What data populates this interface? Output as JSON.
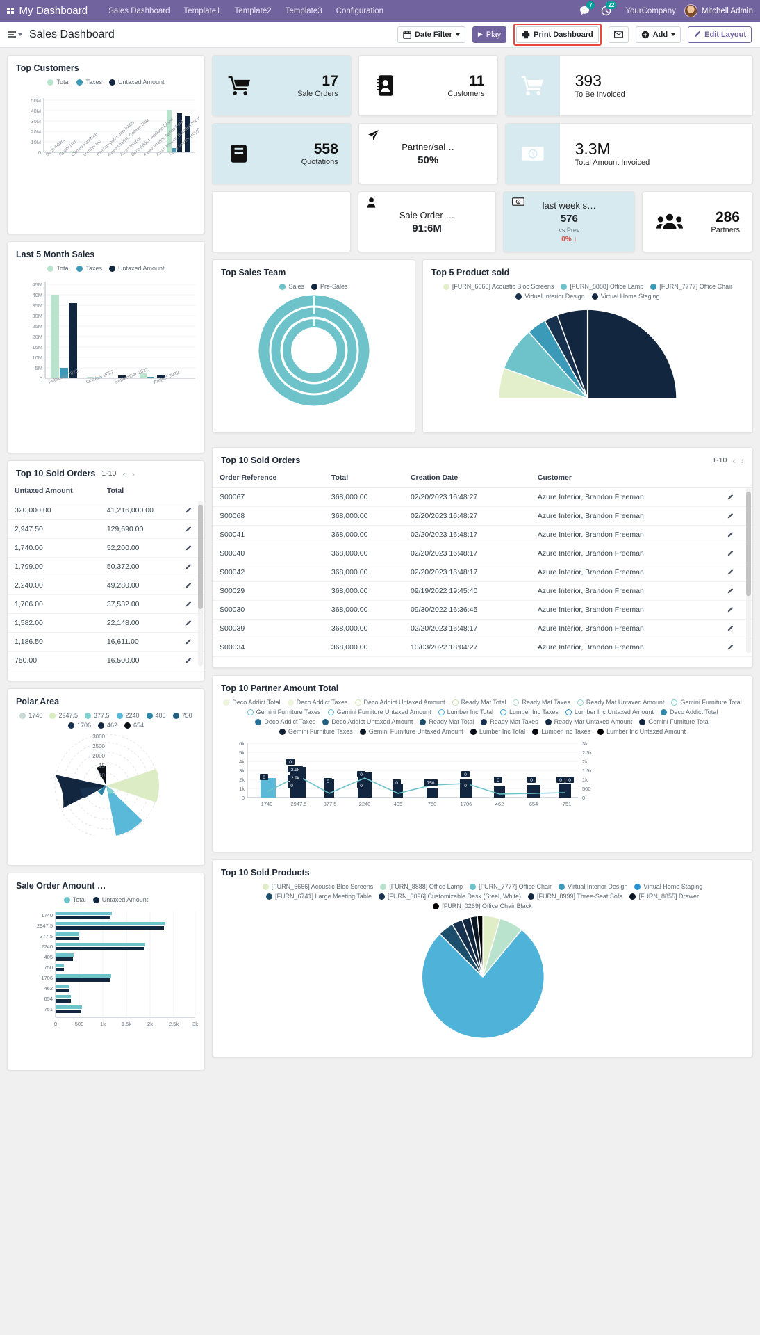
{
  "navbar": {
    "apps_icon": "grid-apps-icon",
    "brand": "My Dashboard",
    "menus": [
      "Sales Dashboard",
      "Template1",
      "Template2",
      "Template3",
      "Configuration"
    ],
    "messages_badge": "7",
    "activities_badge": "22",
    "company": "YourCompany",
    "user": "Mitchell Admin",
    "brand_color": "#71639e"
  },
  "controlbar": {
    "title": "Sales Dashboard",
    "date_filter": "Date Filter",
    "play": "Play",
    "print": "Print Dashboard",
    "add": "Add",
    "edit_layout": "Edit Layout",
    "highlight_color": "#e8483f"
  },
  "kpis": [
    {
      "id": "sale-orders",
      "value": "17",
      "label": "Sale Orders",
      "icon": "cart-icon",
      "style": "tinted"
    },
    {
      "id": "customers",
      "value": "11",
      "label": "Customers",
      "icon": "contact-icon",
      "style": "plain"
    },
    {
      "id": "to-be-invoiced",
      "value": "393",
      "label": "To Be Invoiced",
      "icon": "cart-icon",
      "style": "wide"
    },
    {
      "id": "quotations",
      "value": "558",
      "label": "Quotations",
      "icon": "book-icon",
      "style": "tinted"
    },
    {
      "id": "partner-sale",
      "value": "50%",
      "label": "Partner/sal…",
      "icon": "paper-plane-icon",
      "style": "center"
    },
    {
      "id": "total-invoiced",
      "value": "3.3M",
      "label": "Total Amount Invoiced",
      "icon": "banknote-icon",
      "style": "wide"
    },
    {
      "id": "empty",
      "value": "",
      "label": "",
      "icon": "",
      "style": "empty"
    },
    {
      "id": "sale-order-amt",
      "value": "91:6M",
      "label": "Sale Order …",
      "icon": "user-icon",
      "style": "center"
    }
  ],
  "kpi_week": {
    "label": "last week s…",
    "value": "576",
    "sub": "vs Prev",
    "delta": "0%",
    "delta_arrow": "↓",
    "icon": "banknote-icon"
  },
  "kpi_partners": {
    "value": "286",
    "label": "Partners",
    "icon": "people-icon"
  },
  "chart_data": [
    {
      "id": "top-customers",
      "title": "Top Customers",
      "type": "bar",
      "legend": [
        {
          "label": "Total",
          "color": "#b9e3cd"
        },
        {
          "label": "Taxes",
          "color": "#3b9ab8"
        },
        {
          "label": "Untaxed Amount",
          "color": "#12263f"
        }
      ],
      "categories": [
        "Deco Addict",
        "Ready Mat",
        "Gemini Furniture",
        "Lumber Inc",
        "YourCompany, Joel Willis",
        "Azure Interior, Colleen Diaz",
        "Azure Interior",
        "Deco Addict, Addison Olson",
        "Azure Interior, Nicole Ford",
        "Azure Interior, Brandon Freeman",
        "Azure Interior (copy)"
      ],
      "ytick_labels": [
        "50M",
        "40M",
        "30M",
        "20M",
        "10M",
        "0"
      ],
      "ylim": [
        0,
        50
      ],
      "series": [
        {
          "name": "Total",
          "values": [
            0,
            0,
            0,
            0.3,
            0,
            0.5,
            0,
            0,
            0,
            41,
            0
          ]
        },
        {
          "name": "Taxes",
          "values": [
            0,
            0,
            0,
            0,
            0,
            0,
            0,
            0,
            0,
            0,
            0
          ]
        },
        {
          "name": "Untaxed Amount",
          "values": [
            0,
            0,
            0,
            0,
            0,
            0,
            0,
            0,
            0,
            38,
            36
          ]
        }
      ],
      "grid": true,
      "legend_position": "top"
    },
    {
      "id": "last-5-month-sales",
      "title": "Last 5 Month Sales",
      "type": "bar",
      "legend": [
        {
          "label": "Total",
          "color": "#b9e3cd"
        },
        {
          "label": "Taxes",
          "color": "#3b9ab8"
        },
        {
          "label": "Untaxed Amount",
          "color": "#12263f"
        }
      ],
      "categories": [
        "February 2023",
        "October 2022",
        "September 2022",
        "August 2022"
      ],
      "ytick_labels": [
        "45M",
        "40M",
        "35M",
        "30M",
        "25M",
        "20M",
        "15M",
        "10M",
        "5M",
        "0"
      ],
      "ylim": [
        0,
        45
      ],
      "series": [
        {
          "name": "Total",
          "values": [
            40.0,
            0.3,
            0.2,
            1.0
          ]
        },
        {
          "name": "Taxes",
          "values": [
            5.0,
            0.1,
            0.1,
            0.3
          ]
        },
        {
          "name": "Untaxed Amount",
          "values": [
            36.0,
            0.2,
            0.6,
            1.0
          ]
        }
      ],
      "grid": true,
      "legend_position": "top"
    },
    {
      "id": "top-sales-team",
      "title": "Top Sales Team",
      "type": "doughnut",
      "legend": [
        {
          "label": "Sales",
          "color": "#6ec3cb"
        },
        {
          "label": "Pre-Sales",
          "color": "#12263f"
        }
      ],
      "values": [
        88,
        12
      ],
      "rings": 3
    },
    {
      "id": "top-5-product-sold",
      "title": "Top 5 Product sold",
      "type": "pie",
      "legend": [
        {
          "label": "[FURN_6666] Acoustic Bloc Screens",
          "color": "#e3eecb"
        },
        {
          "label": "[FURN_8888] Office Lamp",
          "color": "#6ec3cb"
        },
        {
          "label": "[FURN_7777] Office Chair",
          "color": "#3b9ab8"
        },
        {
          "label": "Virtual Interior Design",
          "color": "#17314f"
        },
        {
          "label": "Virtual Home Staging",
          "color": "#12263f"
        }
      ],
      "values": [
        18,
        10,
        4,
        3,
        65
      ]
    },
    {
      "id": "polar-area",
      "title": "Polar Area",
      "type": "polar",
      "legend": [
        {
          "label": "1740",
          "color": "#c9d9d6"
        },
        {
          "label": "2947.5",
          "color": "#d9ecc0"
        },
        {
          "label": "377.5",
          "color": "#7fd0ce"
        },
        {
          "label": "2240",
          "color": "#5ab9d8"
        },
        {
          "label": "405",
          "color": "#2e86a8"
        },
        {
          "label": "750",
          "color": "#1f5f80"
        },
        {
          "label": "1706",
          "color": "#17314f"
        },
        {
          "label": "462",
          "color": "#12263f"
        },
        {
          "label": "654",
          "color": "#0b0f16"
        }
      ],
      "rtick_labels": [
        "3000",
        "2500",
        "2000",
        "15",
        "10"
      ],
      "values": [
        1740,
        2947.5,
        377.5,
        2240,
        405,
        750,
        1706,
        462,
        654
      ]
    },
    {
      "id": "top-10-partner-amount-total",
      "title": "Top 10 Partner Amount Total",
      "type": "bar",
      "legend": [
        {
          "label": "Deco Addict Total",
          "color": "#edf4dd",
          "ring": false
        },
        {
          "label": "Deco Addict Taxes",
          "color": "#edf4dd",
          "ring": false
        },
        {
          "label": "Deco Addict Untaxed Amount",
          "color": "#d7ebb2",
          "ring": true
        },
        {
          "label": "Ready Mat Total",
          "color": "#c9e6a8",
          "ring": true
        },
        {
          "label": "Ready Mat Taxes",
          "color": "#a8dcc0",
          "ring": true
        },
        {
          "label": "Ready Mat Untaxed Amount",
          "color": "#8ed6c8",
          "ring": true
        },
        {
          "label": "Gemini Furniture Total",
          "color": "#76cfd0",
          "ring": true
        },
        {
          "label": "Gemini Furniture Taxes",
          "color": "#62c6d4",
          "ring": true
        },
        {
          "label": "Gemini Furniture Untaxed Amount",
          "color": "#55bcd9",
          "ring": true
        },
        {
          "label": "Lumber Inc Total",
          "color": "#46ace0",
          "ring": true
        },
        {
          "label": "Lumber Inc Taxes",
          "color": "#2fa3e0",
          "ring": true
        },
        {
          "label": "Lumber Inc Untaxed Amount",
          "color": "#2a93d4",
          "ring": true
        },
        {
          "label": "Deco Addict Total",
          "color": "#2e86a8",
          "ring": false
        },
        {
          "label": "Deco Addict Taxes",
          "color": "#276f94",
          "ring": false
        },
        {
          "label": "Deco Addict Untaxed Amount",
          "color": "#23607f",
          "ring": false
        },
        {
          "label": "Ready Mat Total",
          "color": "#1d4e6b",
          "ring": false
        },
        {
          "label": "Ready Mat Taxes",
          "color": "#17314f",
          "ring": false
        },
        {
          "label": "Ready Mat Untaxed Amount",
          "color": "#142a45",
          "ring": false
        },
        {
          "label": "Gemini Furniture Total",
          "color": "#12263f",
          "ring": false
        },
        {
          "label": "Gemini Furniture Taxes",
          "color": "#101f33",
          "ring": false
        },
        {
          "label": "Gemini Furniture Untaxed Amount",
          "color": "#0c1726",
          "ring": false
        },
        {
          "label": "Lumber Inc Total",
          "color": "#080f1a",
          "ring": false
        },
        {
          "label": "Lumber Inc Taxes",
          "color": "#05090f",
          "ring": false
        },
        {
          "label": "Lumber Inc Untaxed Amount",
          "color": "#000000",
          "ring": false
        }
      ],
      "categories": [
        "1740",
        "2947.5",
        "377.5",
        "2240",
        "405",
        "750",
        "1706",
        "462",
        "654",
        "751"
      ],
      "left_axis_labels": [
        "6k",
        "5k",
        "4k",
        "3k",
        "2k",
        "1k",
        "0"
      ],
      "right_axis_labels": [
        "3k",
        "2.5k",
        "2k",
        "1.5k",
        "1k",
        "500",
        "0"
      ],
      "bar_labels": [
        [
          "0"
        ],
        [
          "0",
          "2.9k",
          "2.9k",
          "0"
        ],
        [
          "0"
        ],
        [
          "0",
          "0"
        ],
        [
          "0"
        ],
        [
          "750"
        ],
        [
          "0",
          "0"
        ],
        [
          "0"
        ],
        [
          "0"
        ],
        [
          "0",
          "0"
        ]
      ],
      "series": [
        {
          "name": "bars",
          "values": [
            1740,
            2947.5,
            377.5,
            2240,
            405,
            750,
            1706,
            462,
            654,
            751
          ]
        }
      ],
      "grid": true
    },
    {
      "id": "sale-order-amount",
      "title": "Sale Order Amount …",
      "type": "bar-horizontal",
      "legend": [
        {
          "label": "Total",
          "color": "#6ec3cb"
        },
        {
          "label": "Untaxed Amount",
          "color": "#12263f"
        }
      ],
      "categories": [
        "1740",
        "2947.5",
        "377.5",
        "2240",
        "405",
        "750",
        "1706",
        "462",
        "654",
        "751"
      ],
      "xtick_labels": [
        "0",
        "500",
        "1k",
        "1.5k",
        "2k",
        "2.5k",
        "3k"
      ],
      "xlim": [
        0,
        3000
      ],
      "series": [
        {
          "name": "Total",
          "values": [
            1200,
            2320,
            500,
            1900,
            380,
            180,
            1180,
            300,
            330,
            560
          ]
        },
        {
          "name": "Untaxed Amount",
          "values": [
            1160,
            2300,
            480,
            1880,
            370,
            170,
            1150,
            290,
            320,
            540
          ]
        }
      ]
    },
    {
      "id": "top-10-sold-products",
      "title": "Top 10 Sold Products",
      "type": "pie",
      "legend": [
        {
          "label": "[FURN_6666] Acoustic Bloc Screens",
          "color": "#dfeec6"
        },
        {
          "label": "[FURN_8888] Office Lamp",
          "color": "#b9e3cd"
        },
        {
          "label": "[FURN_7777] Office Chair",
          "color": "#6ec3cb"
        },
        {
          "label": "Virtual Interior Design",
          "color": "#3b9ab8"
        },
        {
          "label": "Virtual Home Staging",
          "color": "#2a93d4"
        },
        {
          "label": "[FURN_6741] Large Meeting Table",
          "color": "#1d4e6b"
        },
        {
          "label": "[FURN_0096] Customizable Desk (Steel, White)",
          "color": "#17314f"
        },
        {
          "label": "[FURN_8999] Three-Seat Sofa",
          "color": "#12263f"
        },
        {
          "label": "[FURN_8855] Drawer",
          "color": "#0c1726"
        },
        {
          "label": "[FURN_0269] Office Chair Black",
          "color": "#000000"
        }
      ],
      "values": [
        12,
        9,
        55,
        6,
        5,
        4,
        3,
        3,
        2,
        1
      ]
    }
  ],
  "table_left": {
    "title": "Top 10 Sold Orders",
    "pager": "1-10",
    "columns": [
      "Untaxed Amount",
      "Total",
      ""
    ],
    "rows": [
      [
        "320,000.00",
        "41,216,000.00"
      ],
      [
        "2,947.50",
        "129,690.00"
      ],
      [
        "1,740.00",
        "52,200.00"
      ],
      [
        "1,799.00",
        "50,372.00"
      ],
      [
        "2,240.00",
        "49,280.00"
      ],
      [
        "1,706.00",
        "37,532.00"
      ],
      [
        "1,582.00",
        "22,148.00"
      ],
      [
        "1,186.50",
        "16,611.00"
      ],
      [
        "750.00",
        "16,500.00"
      ]
    ],
    "row_action_icon": "pencil-icon"
  },
  "table_right": {
    "title": "Top 10 Sold Orders",
    "pager": "1-10",
    "columns": [
      "Order Reference",
      "Total",
      "Creation Date",
      "Customer",
      ""
    ],
    "rows": [
      [
        "S00067",
        "368,000.00",
        "02/20/2023 16:48:27",
        "Azure Interior, Brandon Freeman"
      ],
      [
        "S00068",
        "368,000.00",
        "02/20/2023 16:48:27",
        "Azure Interior, Brandon Freeman"
      ],
      [
        "S00041",
        "368,000.00",
        "02/20/2023 16:48:17",
        "Azure Interior, Brandon Freeman"
      ],
      [
        "S00040",
        "368,000.00",
        "02/20/2023 16:48:17",
        "Azure Interior, Brandon Freeman"
      ],
      [
        "S00042",
        "368,000.00",
        "02/20/2023 16:48:17",
        "Azure Interior, Brandon Freeman"
      ],
      [
        "S00029",
        "368,000.00",
        "09/19/2022 19:45:40",
        "Azure Interior, Brandon Freeman"
      ],
      [
        "S00030",
        "368,000.00",
        "09/30/2022 16:36:45",
        "Azure Interior, Brandon Freeman"
      ],
      [
        "S00039",
        "368,000.00",
        "02/20/2023 16:48:17",
        "Azure Interior, Brandon Freeman"
      ],
      [
        "S00034",
        "368,000.00",
        "10/03/2022 18:04:27",
        "Azure Interior, Brandon Freeman"
      ]
    ],
    "row_action_icon": "pencil-icon"
  }
}
